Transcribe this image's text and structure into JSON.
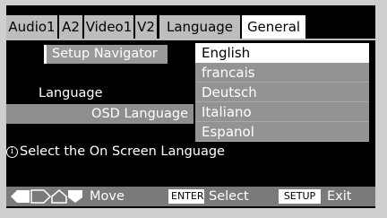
{
  "tabs": [
    {
      "label": "Audio1"
    },
    {
      "label": "A2"
    },
    {
      "label": "Video1"
    },
    {
      "label": "V2"
    },
    {
      "label": "Language"
    },
    {
      "label": "General"
    }
  ],
  "active_tab": "General",
  "menu": {
    "setup_navigator": "Setup Navigator",
    "language_heading": "Language",
    "osd_language": "OSD Language"
  },
  "dropdown": {
    "options": [
      "English",
      "francais",
      "Deutsch",
      "Italiano",
      "Espanol"
    ],
    "selected": "English"
  },
  "help": {
    "icon": "info-icon",
    "text": "Select the On Screen Language"
  },
  "footer": {
    "move_label": "Move",
    "enter_key": "ENTER",
    "select_label": "Select",
    "setup_key": "SETUP",
    "exit_label": "Exit"
  },
  "colors": {
    "screen_bg": "#000000",
    "tab_bg": "#bdbdbd",
    "active_tab_bg": "#ffffff",
    "highlight_bg": "#8e8e8e",
    "selected_option_bg": "#ffffff"
  }
}
